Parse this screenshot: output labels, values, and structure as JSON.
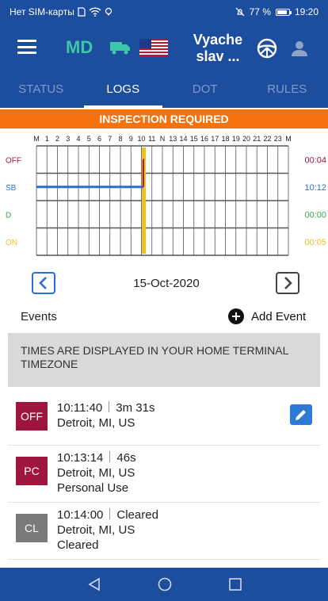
{
  "status_bar": {
    "carrier": "Нет SIM-карты",
    "battery": "77 %",
    "time": "19:20"
  },
  "header": {
    "jurisdiction": "MD",
    "driver_name_line1": "Vyache",
    "driver_name_line2": "slav ...",
    "icons": [
      "menu-icon",
      "truck-icon",
      "us-flag-icon",
      "steering-wheel-icon",
      "user-icon"
    ]
  },
  "tabs": [
    {
      "label": "STATUS",
      "active": false
    },
    {
      "label": "LOGS",
      "active": true
    },
    {
      "label": "DOT",
      "active": false
    },
    {
      "label": "RULES",
      "active": false
    }
  ],
  "banner": {
    "text": "INSPECTION REQUIRED",
    "color": "#f5720c"
  },
  "log_chart": {
    "hour_labels": [
      "M",
      "1",
      "2",
      "3",
      "4",
      "5",
      "6",
      "7",
      "8",
      "9",
      "10",
      "11",
      "N",
      "13",
      "14",
      "15",
      "16",
      "17",
      "18",
      "19",
      "20",
      "21",
      "22",
      "23",
      "M"
    ],
    "rows": [
      {
        "label": "OFF",
        "total": "00:04",
        "color": "#a0153e"
      },
      {
        "label": "SB",
        "total": "10:12",
        "color": "#2b6fd3"
      },
      {
        "label": "D",
        "total": "00:00",
        "color": "#3aa84a"
      },
      {
        "label": "ON",
        "total": "00:05",
        "color": "#f0c020"
      }
    ],
    "segments": [
      {
        "status": "SB",
        "start_hour": 0,
        "end_hour": 10.18
      },
      {
        "status": "OFF",
        "start_hour": 10.18,
        "end_hour": 10.25
      }
    ],
    "current_time_marker_hour": 10.23,
    "marker_color": "#f0c020"
  },
  "date_nav": {
    "date": "15-Oct-2020"
  },
  "events_section": {
    "title": "Events",
    "add_label": "Add Event"
  },
  "timezone_notice": "TIMES ARE DISPLAYED IN YOUR HOME TERMINAL TIMEZONE",
  "events": [
    {
      "code": "OFF",
      "color": "#a0153e",
      "time": "10:11:40",
      "duration": "3m 31s",
      "location": "Detroit, MI, US",
      "note": "",
      "editable": true
    },
    {
      "code": "PC",
      "color": "#a0153e",
      "time": "10:13:14",
      "duration": "46s",
      "location": "Detroit, MI, US",
      "note": "Personal Use",
      "editable": false
    },
    {
      "code": "CL",
      "color": "#7a7a7a",
      "time": "10:14:00",
      "duration": "Cleared",
      "location": "Detroit, MI, US",
      "note": "Cleared",
      "editable": false
    }
  ]
}
